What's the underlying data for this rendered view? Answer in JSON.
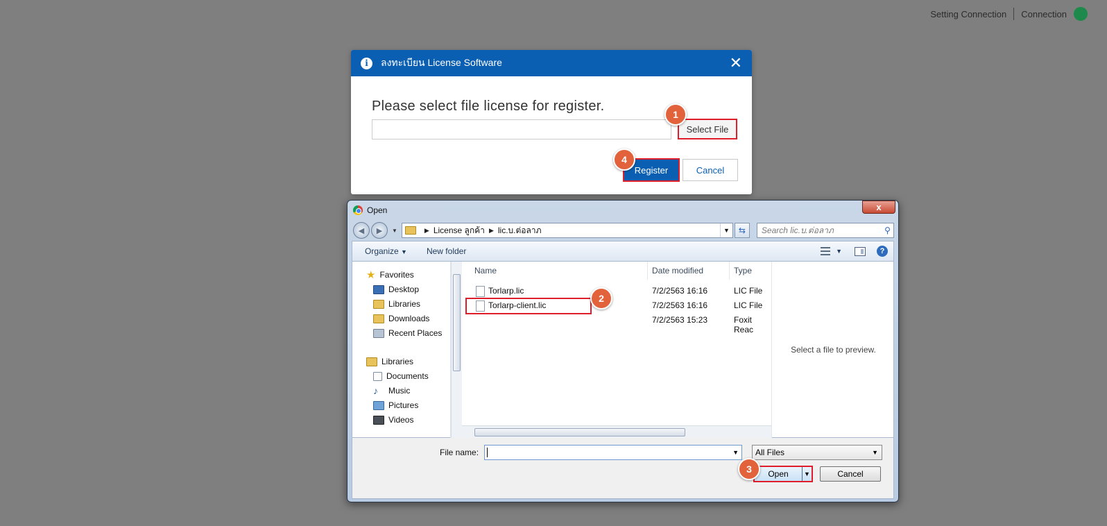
{
  "topbar": {
    "setting_label": "Setting Connection",
    "connection_label": "Connection",
    "status_color": "#1d8a4c"
  },
  "license_dialog": {
    "title": "ลงทะเบียน License Software",
    "prompt": "Please select file license for register.",
    "file_value": "",
    "select_file_label": "Select File",
    "register_label": "Register",
    "cancel_label": "Cancel",
    "header_color": "#0b5fb3"
  },
  "steps": {
    "one": "1",
    "two": "2",
    "three": "3",
    "four": "4"
  },
  "open_dialog": {
    "title": "Open",
    "close_label": "x",
    "breadcrumb": [
      "License ลูกค้า",
      "lic.บ.ต่อลาภ"
    ],
    "search_placeholder": "Search lic.บ.ต่อลาภ",
    "toolbar": {
      "organize": "Organize",
      "new_folder": "New folder",
      "help": "?"
    },
    "favorites_header": "Favorites",
    "favorites": [
      "Desktop",
      "Libraries",
      "Downloads",
      "Recent Places"
    ],
    "libraries_header": "Libraries",
    "libraries": [
      "Documents",
      "Music",
      "Pictures",
      "Videos"
    ],
    "columns": {
      "name": "Name",
      "date": "Date modified",
      "type": "Type"
    },
    "files": [
      {
        "name": "Torlarp.lic",
        "date": "7/2/2563 16:16",
        "type": "LIC File"
      },
      {
        "name": "Torlarp-client.lic",
        "date": "7/2/2563 16:16",
        "type": "LIC File"
      },
      {
        "name": "",
        "date": "7/2/2563 15:23",
        "type": "Foxit Reac"
      }
    ],
    "preview_text": "Select a file to preview.",
    "file_name_label": "File name:",
    "file_name_value": "",
    "file_type": "All Files",
    "open_label": "Open",
    "cancel_label": "Cancel"
  }
}
